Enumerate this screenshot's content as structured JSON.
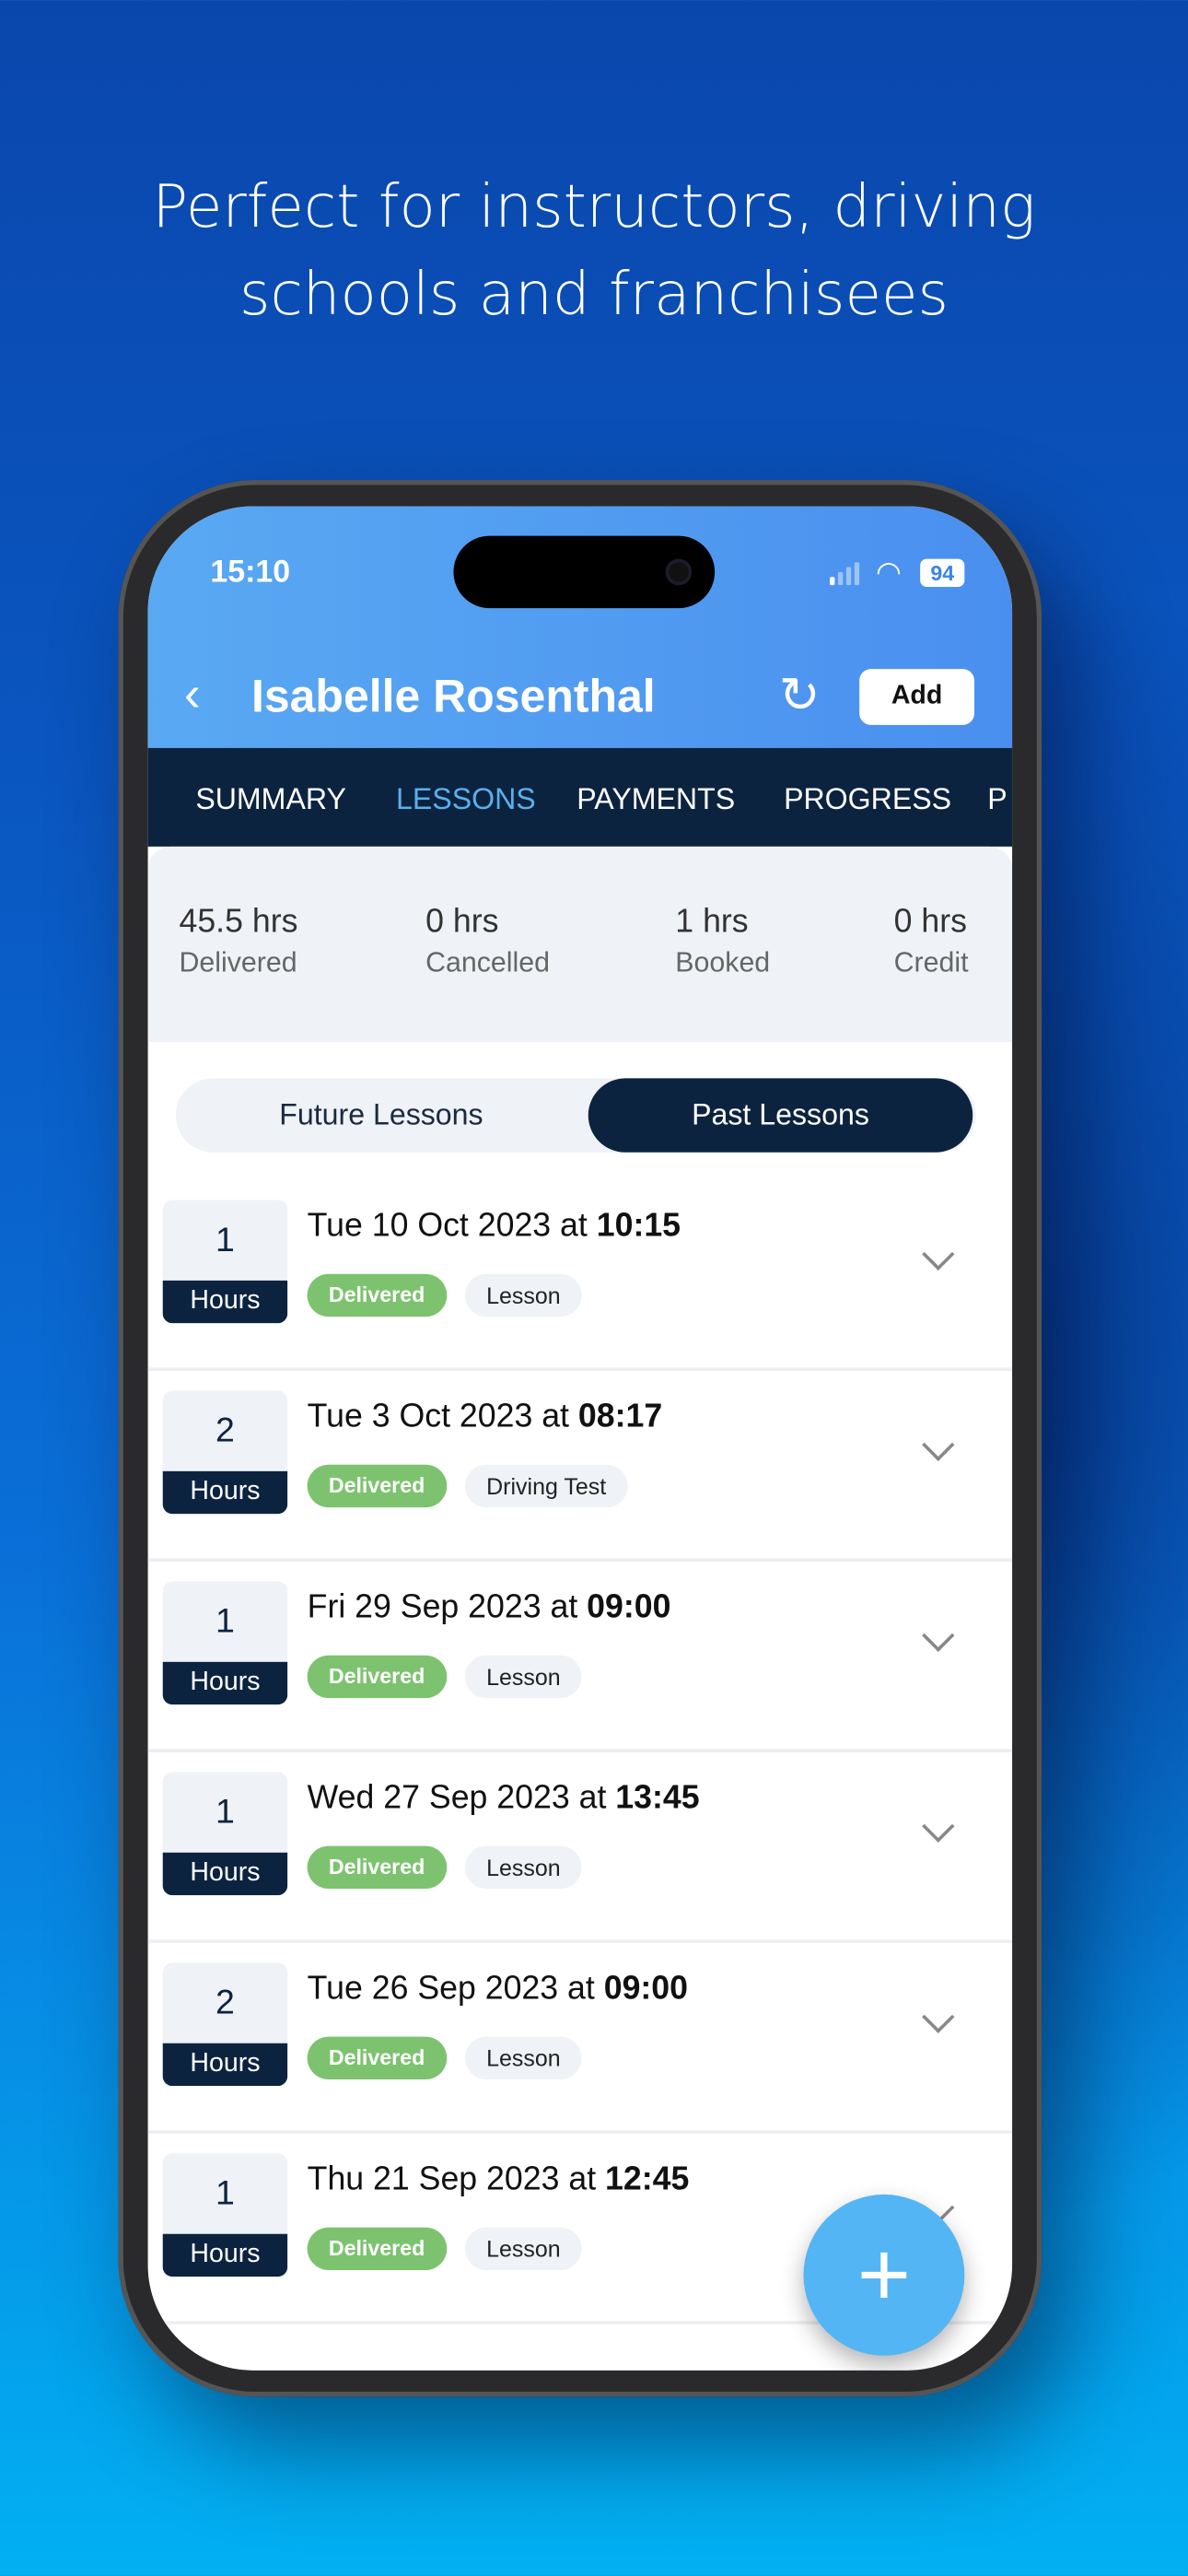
{
  "headline": {
    "line1": "Perfect for instructors, driving",
    "line2": "schools and franchisees"
  },
  "status_bar": {
    "time": "15:10",
    "battery": "94",
    "wifi_icon": "wifi-icon",
    "signal_icon": "signal-icon"
  },
  "header": {
    "back_icon": "chevron-left-icon",
    "title": "Isabelle Rosenthal",
    "refresh_icon": "refresh-icon",
    "add_label": "Add",
    "refresh_glyph": "↻",
    "back_glyph": "‹"
  },
  "tabs": [
    {
      "label": "SUMMARY",
      "active": false
    },
    {
      "label": "LESSONS",
      "active": true
    },
    {
      "label": "PAYMENTS",
      "active": false
    },
    {
      "label": "PROGRESS",
      "active": false
    },
    {
      "label": "P",
      "active": false
    }
  ],
  "summary": [
    {
      "value": "45.5 hrs",
      "label": "Delivered"
    },
    {
      "value": "0 hrs",
      "label": "Cancelled"
    },
    {
      "value": "1 hrs",
      "label": "Booked"
    },
    {
      "value": "0 hrs",
      "label": "Credit"
    }
  ],
  "segment": {
    "future": "Future Lessons",
    "past": "Past Lessons",
    "selected": "Past Lessons"
  },
  "hours_unit": "Hours",
  "lessons": [
    {
      "hours": "1",
      "date": "Tue 10 Oct 2023 at",
      "time": "10:15",
      "status": "Delivered",
      "type": "Lesson"
    },
    {
      "hours": "2",
      "date": "Tue 3 Oct 2023 at",
      "time": "08:17",
      "status": "Delivered",
      "type": "Driving Test"
    },
    {
      "hours": "1",
      "date": "Fri 29 Sep 2023 at",
      "time": "09:00",
      "status": "Delivered",
      "type": "Lesson"
    },
    {
      "hours": "1",
      "date": "Wed 27 Sep 2023 at",
      "time": "13:45",
      "status": "Delivered",
      "type": "Lesson"
    },
    {
      "hours": "2",
      "date": "Tue 26 Sep 2023 at",
      "time": "09:00",
      "status": "Delivered",
      "type": "Lesson"
    },
    {
      "hours": "1",
      "date": "Thu 21 Sep 2023 at",
      "time": "12:45",
      "status": "Delivered",
      "type": "Lesson"
    }
  ],
  "fab": {
    "icon": "plus-icon",
    "glyph": "+"
  },
  "colors": {
    "header": "#4a8fef",
    "nav": "#0c2340",
    "active_tab": "#5ab0ec",
    "delivered": "#7dc36f",
    "fab": "#54b5f5"
  }
}
